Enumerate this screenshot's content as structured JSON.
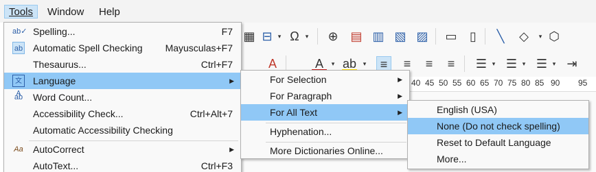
{
  "menubar": {
    "items": [
      {
        "label": "Tools",
        "mnemonic_index": 0
      },
      {
        "label": "Window",
        "mnemonic_index": 0
      },
      {
        "label": "Help",
        "mnemonic_index": 0
      }
    ]
  },
  "ruler": {
    "ticks": [
      "40",
      "45",
      "50",
      "55",
      "60",
      "65",
      "70",
      "75",
      "80",
      "85",
      "90",
      "95"
    ]
  },
  "tools_menu": {
    "items": [
      {
        "icon": "spelling-icon",
        "label": "Spelling...",
        "shortcut": "F7"
      },
      {
        "icon": "auto-spellcheck-icon",
        "label": "Automatic Spell Checking",
        "shortcut": "Mayusculas+F7"
      },
      {
        "icon": "",
        "label": "Thesaurus...",
        "shortcut": "Ctrl+F7"
      },
      {
        "icon": "language-icon",
        "label": "Language",
        "shortcut": ""
      },
      {
        "icon": "word-count-icon",
        "label": "Word Count...",
        "shortcut": ""
      },
      {
        "icon": "",
        "label": "Accessibility Check...",
        "shortcut": "Ctrl+Alt+7"
      },
      {
        "icon": "",
        "label": "Automatic Accessibility Checking",
        "shortcut": ""
      },
      {
        "icon": "autocorrect-icon",
        "label": "AutoCorrect",
        "shortcut": ""
      },
      {
        "icon": "",
        "label": "AutoText...",
        "shortcut": "Ctrl+F3"
      }
    ]
  },
  "language_menu": {
    "items": [
      {
        "label": "For Selection"
      },
      {
        "label": "For Paragraph"
      },
      {
        "label": "For All Text"
      },
      {
        "label": "Hyphenation..."
      },
      {
        "label": "More Dictionaries Online..."
      }
    ]
  },
  "all_text_menu": {
    "items": [
      {
        "label": "English (USA)"
      },
      {
        "label": "None (Do not check spelling)"
      },
      {
        "label": "Reset to Default Language"
      },
      {
        "label": "More..."
      }
    ]
  }
}
